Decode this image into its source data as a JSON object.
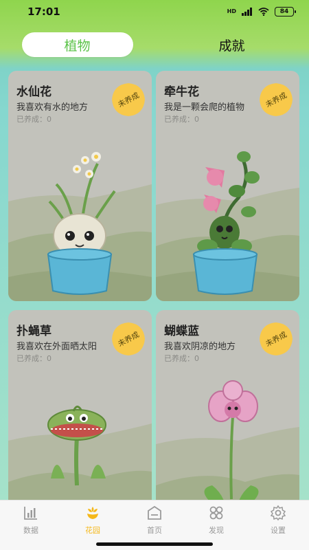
{
  "status_bar": {
    "time": "17:01",
    "network": "HD",
    "battery": "84"
  },
  "top_tabs": [
    {
      "label": "植物",
      "active": true
    },
    {
      "label": "成就",
      "active": false
    }
  ],
  "plants": [
    {
      "name": "水仙花",
      "desc": "我喜欢有水的地方",
      "count": "已养成：0",
      "badge": "未养成",
      "plant": "narcissus"
    },
    {
      "name": "牵牛花",
      "desc": "我是一颗会爬的植物",
      "count": "已养成：0",
      "badge": "未养成",
      "plant": "morning-glory"
    },
    {
      "name": "扑蝇草",
      "desc": "我喜欢在外面晒太阳",
      "count": "已养成：0",
      "badge": "未养成",
      "plant": "flytrap"
    },
    {
      "name": "蝴蝶蓝",
      "desc": "我喜欢阴凉的地方",
      "count": "已养成：0",
      "badge": "未养成",
      "plant": "orchid"
    }
  ],
  "bottom_nav": [
    {
      "label": "数据",
      "icon": "chart-icon",
      "active": false
    },
    {
      "label": "花园",
      "icon": "flower-icon",
      "active": true
    },
    {
      "label": "首页",
      "icon": "home-icon",
      "active": false
    },
    {
      "label": "发现",
      "icon": "discover-icon",
      "active": false
    },
    {
      "label": "设置",
      "icon": "gear-icon",
      "active": false
    }
  ],
  "colors": {
    "accent_green": "#5cc34a",
    "nav_active": "#f5b81a",
    "badge": "#f8c94a"
  }
}
